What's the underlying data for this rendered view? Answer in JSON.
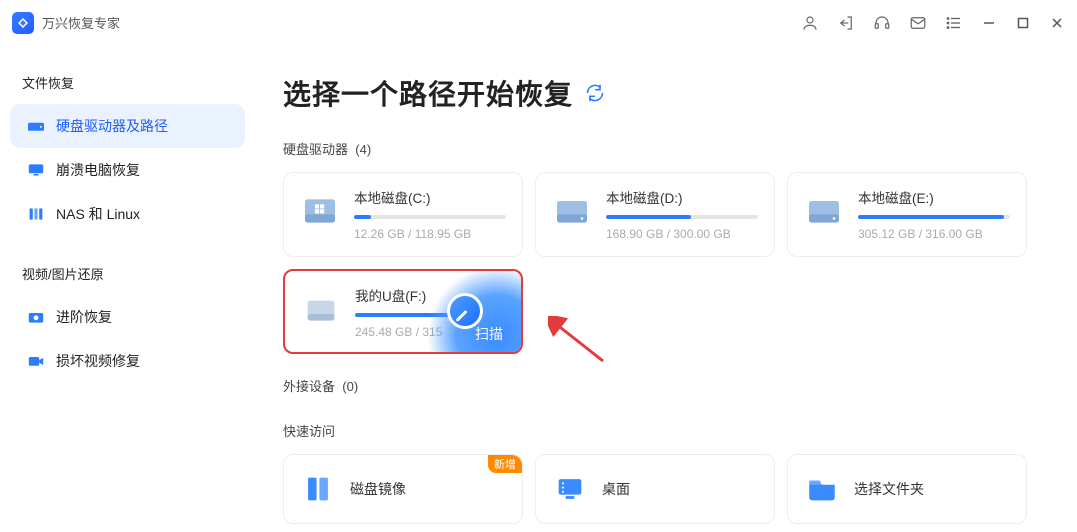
{
  "app": {
    "title": "万兴恢复专家"
  },
  "sidebar": {
    "sections": [
      {
        "title": "文件恢复",
        "items": [
          {
            "label": "硬盘驱动器及路径",
            "icon": "hdd",
            "active": true
          },
          {
            "label": "崩溃电脑恢复",
            "icon": "monitor",
            "active": false
          },
          {
            "label": "NAS 和 Linux",
            "icon": "server",
            "active": false
          }
        ]
      },
      {
        "title": "视频/图片还原",
        "items": [
          {
            "label": "进阶恢复",
            "icon": "camera",
            "active": false
          },
          {
            "label": "损坏视频修复",
            "icon": "video",
            "active": false
          }
        ]
      }
    ]
  },
  "heading": "选择一个路径开始恢复",
  "drives": {
    "title": "硬盘驱动器",
    "count": 4,
    "list": [
      {
        "name": "本地磁盘(C:)",
        "used_pct": 11,
        "stats": "12.26 GB / 118.95 GB",
        "type": "windows",
        "selected": false
      },
      {
        "name": "本地磁盘(D:)",
        "used_pct": 56,
        "stats": "168.90 GB / 300.00 GB",
        "type": "hdd",
        "selected": false
      },
      {
        "name": "本地磁盘(E:)",
        "used_pct": 96,
        "stats": "305.12 GB / 316.00 GB",
        "type": "hdd",
        "selected": false
      },
      {
        "name": "我的U盘(F:)",
        "used_pct": 78,
        "stats": "245.48 GB / 315",
        "type": "usb",
        "selected": true,
        "scan_label": "扫描"
      }
    ]
  },
  "external": {
    "title": "外接设备",
    "count": 0
  },
  "quick": {
    "title": "快速访问",
    "items": [
      {
        "label": "磁盘镜像",
        "icon": "mirror",
        "badge": "新增"
      },
      {
        "label": "桌面",
        "icon": "desktop",
        "badge": null
      },
      {
        "label": "选择文件夹",
        "icon": "folder",
        "badge": null
      }
    ]
  }
}
